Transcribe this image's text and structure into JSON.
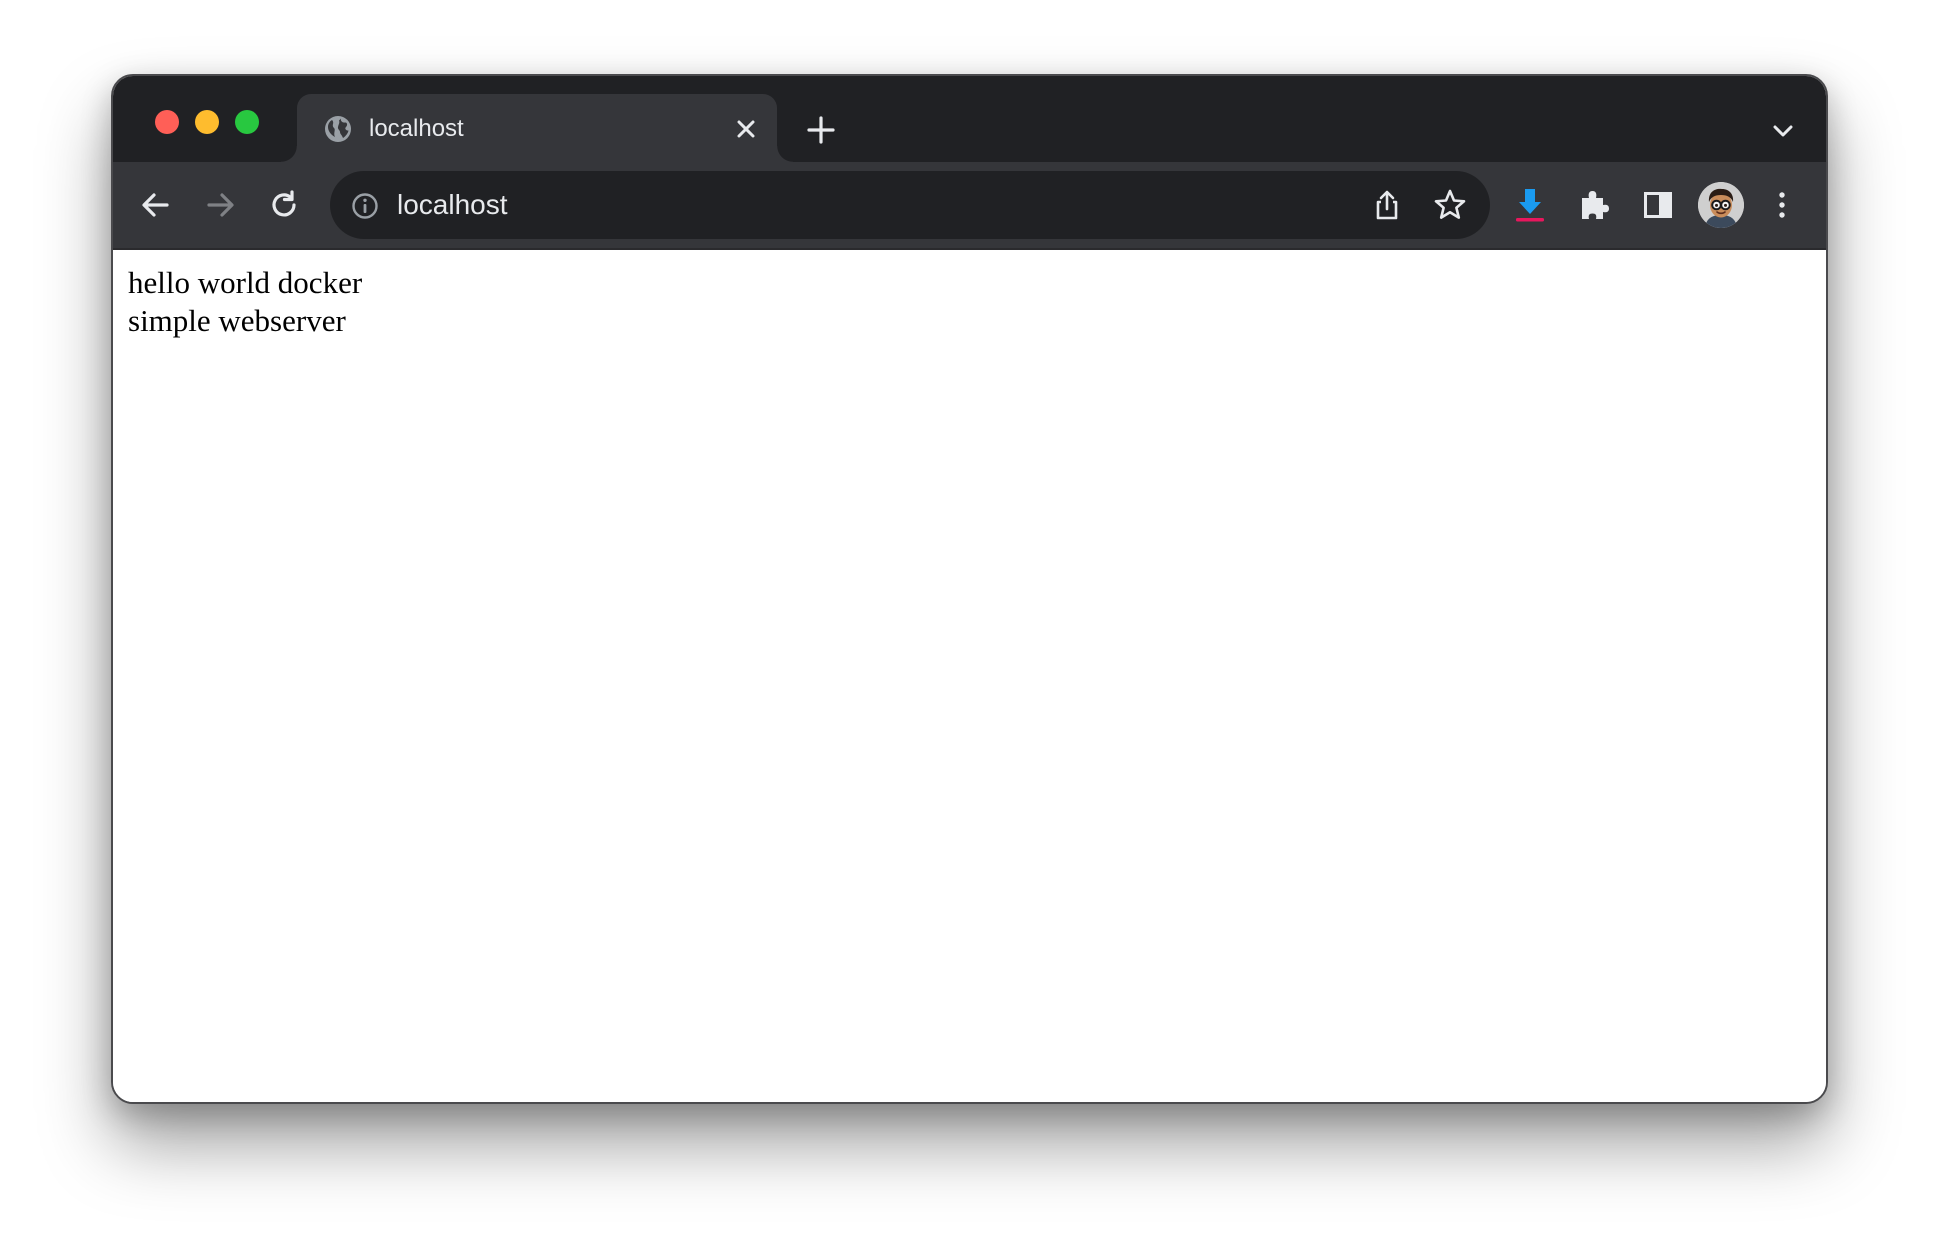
{
  "browser": {
    "tab": {
      "title": "localhost",
      "favicon": "globe-icon",
      "close_icon": "close-icon"
    },
    "new_tab_icon": "plus-icon",
    "tab_search_icon": "chevron-down-icon",
    "toolbar": {
      "back_icon": "arrow-left-icon",
      "forward_icon": "arrow-right-icon",
      "reload_icon": "reload-icon",
      "omnibox": {
        "site_info_icon": "info-icon",
        "url": "localhost",
        "share_icon": "share-icon",
        "bookmark_icon": "star-icon"
      },
      "extensions": [
        "download-extension-icon",
        "puzzle-icon"
      ],
      "side_panel_icon": "side-panel-icon",
      "profile_icon": "avatar",
      "menu_icon": "kebab-menu-icon"
    }
  },
  "page": {
    "lines": [
      "hello world docker",
      "simple webserver"
    ]
  },
  "colors": {
    "traffic_red": "#ff5f57",
    "traffic_yellow": "#febc2e",
    "traffic_green": "#28c840",
    "tabstrip": "#202124",
    "toolbar": "#35363a",
    "download_blue": "#1a9bf0",
    "download_underline": "#e8175d"
  }
}
